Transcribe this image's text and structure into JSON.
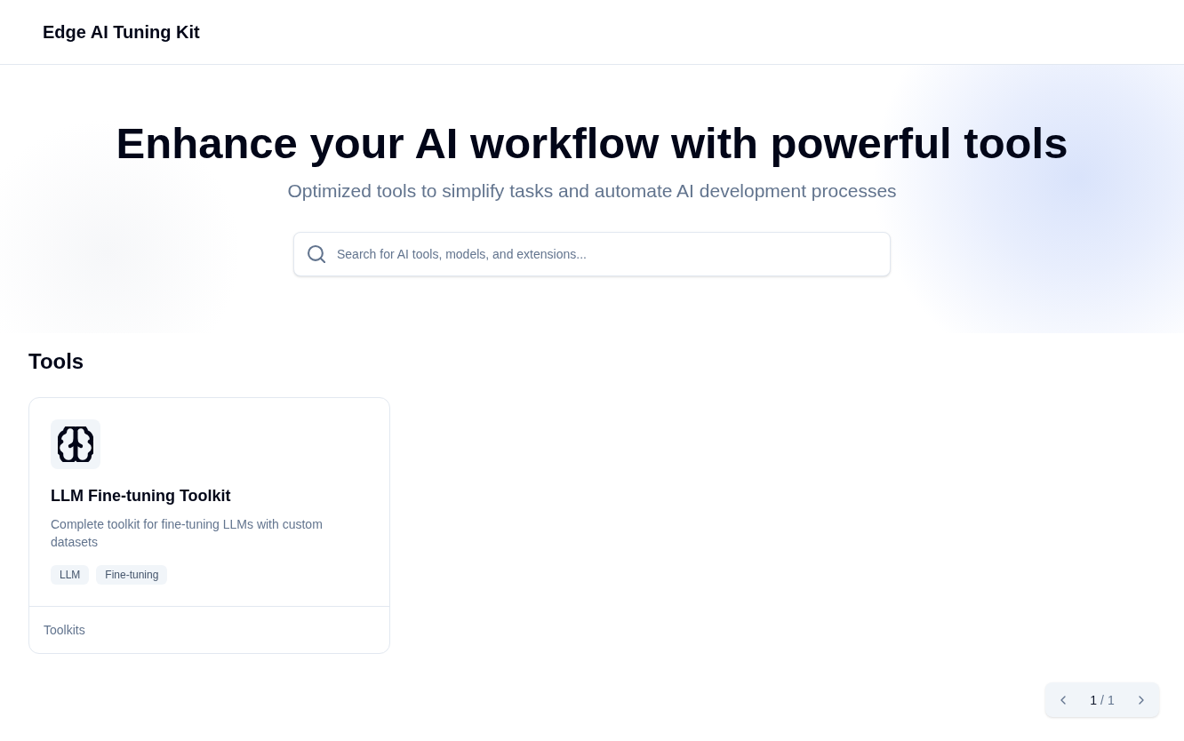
{
  "header": {
    "title": "Edge AI Tuning Kit"
  },
  "hero": {
    "heading": "Enhance your AI workflow with powerful tools",
    "subheading": "Optimized tools to simplify tasks and automate AI development processes",
    "search": {
      "placeholder": "Search for AI tools, models, and extensions..."
    }
  },
  "section": {
    "title": "Tools"
  },
  "tools": [
    {
      "title": "LLM Fine-tuning Toolkit",
      "description": "Complete toolkit for fine-tuning LLMs with custom datasets",
      "tags": [
        "LLM",
        "Fine-tuning"
      ],
      "category": "Toolkits"
    }
  ],
  "pagination": {
    "current": "1",
    "separator": "/",
    "total": "1"
  }
}
